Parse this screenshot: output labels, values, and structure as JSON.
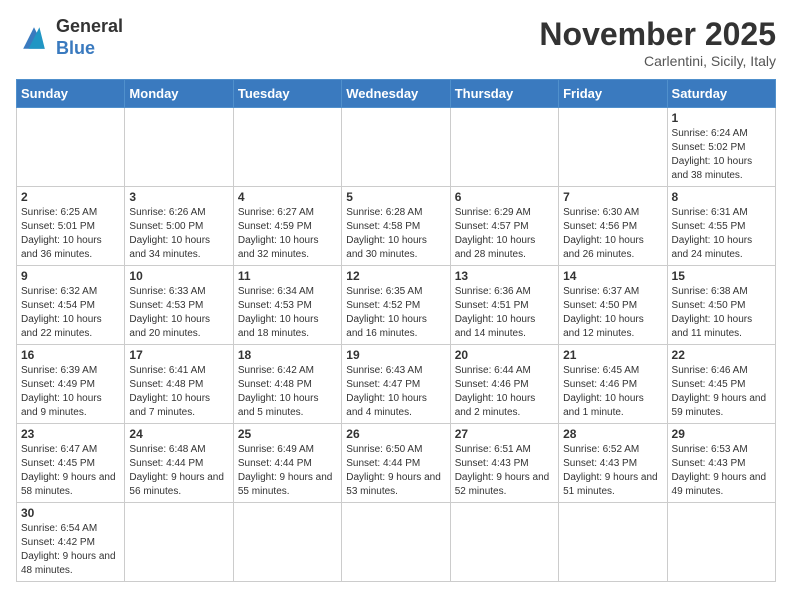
{
  "logo": {
    "text_general": "General",
    "text_blue": "Blue"
  },
  "title": "November 2025",
  "location": "Carlentini, Sicily, Italy",
  "days_of_week": [
    "Sunday",
    "Monday",
    "Tuesday",
    "Wednesday",
    "Thursday",
    "Friday",
    "Saturday"
  ],
  "weeks": [
    [
      {
        "day": "",
        "info": ""
      },
      {
        "day": "",
        "info": ""
      },
      {
        "day": "",
        "info": ""
      },
      {
        "day": "",
        "info": ""
      },
      {
        "day": "",
        "info": ""
      },
      {
        "day": "",
        "info": ""
      },
      {
        "day": "1",
        "info": "Sunrise: 6:24 AM\nSunset: 5:02 PM\nDaylight: 10 hours and 38 minutes."
      }
    ],
    [
      {
        "day": "2",
        "info": "Sunrise: 6:25 AM\nSunset: 5:01 PM\nDaylight: 10 hours and 36 minutes."
      },
      {
        "day": "3",
        "info": "Sunrise: 6:26 AM\nSunset: 5:00 PM\nDaylight: 10 hours and 34 minutes."
      },
      {
        "day": "4",
        "info": "Sunrise: 6:27 AM\nSunset: 4:59 PM\nDaylight: 10 hours and 32 minutes."
      },
      {
        "day": "5",
        "info": "Sunrise: 6:28 AM\nSunset: 4:58 PM\nDaylight: 10 hours and 30 minutes."
      },
      {
        "day": "6",
        "info": "Sunrise: 6:29 AM\nSunset: 4:57 PM\nDaylight: 10 hours and 28 minutes."
      },
      {
        "day": "7",
        "info": "Sunrise: 6:30 AM\nSunset: 4:56 PM\nDaylight: 10 hours and 26 minutes."
      },
      {
        "day": "8",
        "info": "Sunrise: 6:31 AM\nSunset: 4:55 PM\nDaylight: 10 hours and 24 minutes."
      }
    ],
    [
      {
        "day": "9",
        "info": "Sunrise: 6:32 AM\nSunset: 4:54 PM\nDaylight: 10 hours and 22 minutes."
      },
      {
        "day": "10",
        "info": "Sunrise: 6:33 AM\nSunset: 4:53 PM\nDaylight: 10 hours and 20 minutes."
      },
      {
        "day": "11",
        "info": "Sunrise: 6:34 AM\nSunset: 4:53 PM\nDaylight: 10 hours and 18 minutes."
      },
      {
        "day": "12",
        "info": "Sunrise: 6:35 AM\nSunset: 4:52 PM\nDaylight: 10 hours and 16 minutes."
      },
      {
        "day": "13",
        "info": "Sunrise: 6:36 AM\nSunset: 4:51 PM\nDaylight: 10 hours and 14 minutes."
      },
      {
        "day": "14",
        "info": "Sunrise: 6:37 AM\nSunset: 4:50 PM\nDaylight: 10 hours and 12 minutes."
      },
      {
        "day": "15",
        "info": "Sunrise: 6:38 AM\nSunset: 4:50 PM\nDaylight: 10 hours and 11 minutes."
      }
    ],
    [
      {
        "day": "16",
        "info": "Sunrise: 6:39 AM\nSunset: 4:49 PM\nDaylight: 10 hours and 9 minutes."
      },
      {
        "day": "17",
        "info": "Sunrise: 6:41 AM\nSunset: 4:48 PM\nDaylight: 10 hours and 7 minutes."
      },
      {
        "day": "18",
        "info": "Sunrise: 6:42 AM\nSunset: 4:48 PM\nDaylight: 10 hours and 5 minutes."
      },
      {
        "day": "19",
        "info": "Sunrise: 6:43 AM\nSunset: 4:47 PM\nDaylight: 10 hours and 4 minutes."
      },
      {
        "day": "20",
        "info": "Sunrise: 6:44 AM\nSunset: 4:46 PM\nDaylight: 10 hours and 2 minutes."
      },
      {
        "day": "21",
        "info": "Sunrise: 6:45 AM\nSunset: 4:46 PM\nDaylight: 10 hours and 1 minute."
      },
      {
        "day": "22",
        "info": "Sunrise: 6:46 AM\nSunset: 4:45 PM\nDaylight: 9 hours and 59 minutes."
      }
    ],
    [
      {
        "day": "23",
        "info": "Sunrise: 6:47 AM\nSunset: 4:45 PM\nDaylight: 9 hours and 58 minutes."
      },
      {
        "day": "24",
        "info": "Sunrise: 6:48 AM\nSunset: 4:44 PM\nDaylight: 9 hours and 56 minutes."
      },
      {
        "day": "25",
        "info": "Sunrise: 6:49 AM\nSunset: 4:44 PM\nDaylight: 9 hours and 55 minutes."
      },
      {
        "day": "26",
        "info": "Sunrise: 6:50 AM\nSunset: 4:44 PM\nDaylight: 9 hours and 53 minutes."
      },
      {
        "day": "27",
        "info": "Sunrise: 6:51 AM\nSunset: 4:43 PM\nDaylight: 9 hours and 52 minutes."
      },
      {
        "day": "28",
        "info": "Sunrise: 6:52 AM\nSunset: 4:43 PM\nDaylight: 9 hours and 51 minutes."
      },
      {
        "day": "29",
        "info": "Sunrise: 6:53 AM\nSunset: 4:43 PM\nDaylight: 9 hours and 49 minutes."
      }
    ],
    [
      {
        "day": "30",
        "info": "Sunrise: 6:54 AM\nSunset: 4:42 PM\nDaylight: 9 hours and 48 minutes."
      },
      {
        "day": "",
        "info": ""
      },
      {
        "day": "",
        "info": ""
      },
      {
        "day": "",
        "info": ""
      },
      {
        "day": "",
        "info": ""
      },
      {
        "day": "",
        "info": ""
      },
      {
        "day": "",
        "info": ""
      }
    ]
  ]
}
